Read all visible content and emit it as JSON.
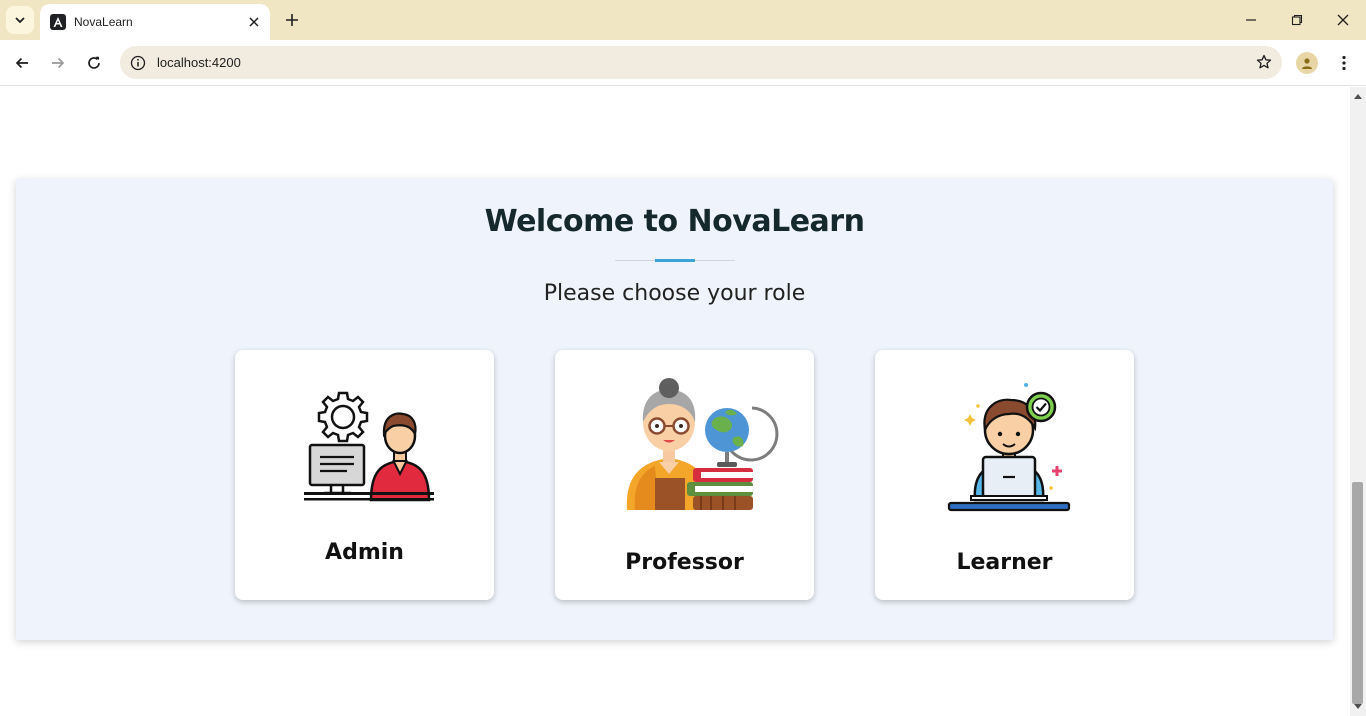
{
  "browser": {
    "tab_title": "NovaLearn",
    "url": "localhost:4200"
  },
  "page": {
    "title": "Welcome to NovaLearn",
    "subtitle": "Please choose your role",
    "accent_color": "#3ba3d6",
    "roles": [
      {
        "label": "Admin",
        "icon": "admin-computer-icon"
      },
      {
        "label": "Professor",
        "icon": "professor-globe-icon"
      },
      {
        "label": "Learner",
        "icon": "learner-laptop-icon"
      }
    ]
  }
}
